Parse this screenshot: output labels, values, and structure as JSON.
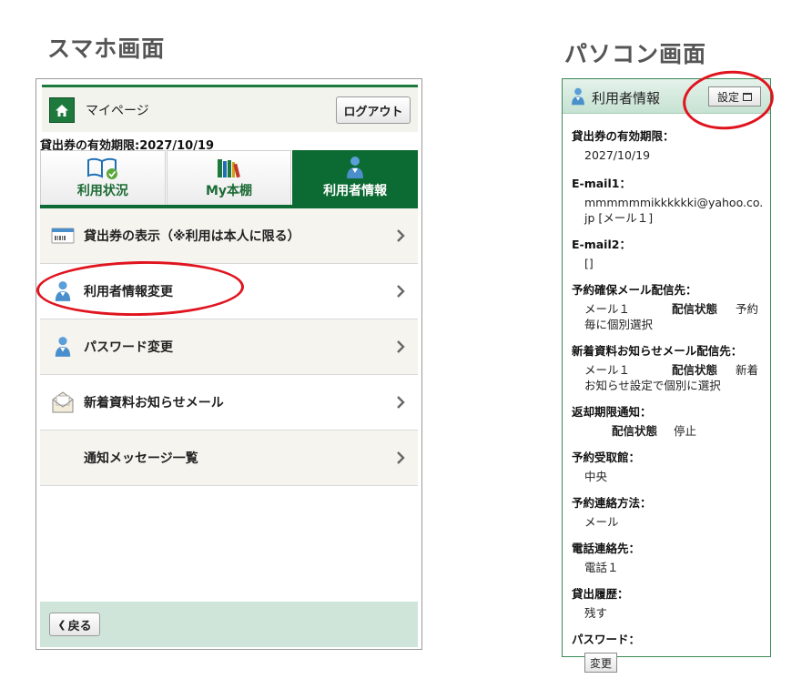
{
  "headings": {
    "phone": "スマホ画面",
    "pc": "パソコン画面"
  },
  "phone": {
    "header": {
      "title": "マイページ",
      "logout_label": "ログアウト",
      "home_icon": "home-icon"
    },
    "expiry": "貸出券の有効期限:2027/10/19",
    "tabs": [
      {
        "label": "利用状況",
        "icon": "book-check-icon",
        "active": false
      },
      {
        "label": "My本棚",
        "icon": "bookshelf-icon",
        "active": false
      },
      {
        "label": "利用者情報",
        "icon": "user-icon",
        "active": true
      }
    ],
    "menu": [
      {
        "label": "貸出券の表示（※利用は本人に限る）",
        "icon": "card-icon"
      },
      {
        "label": "利用者情報変更",
        "icon": "user-icon"
      },
      {
        "label": "パスワード変更",
        "icon": "user-icon"
      },
      {
        "label": "新着資料お知らせメール",
        "icon": "mail-icon"
      },
      {
        "label": "通知メッセージ一覧",
        "icon": ""
      }
    ],
    "footer": {
      "back_label": "戻る"
    }
  },
  "pc": {
    "title": "利用者情報",
    "settings_label": "設定",
    "fields": [
      {
        "label": "貸出券の有効期限：",
        "value": "2027/10/19"
      },
      {
        "label": "E-mail1：",
        "value": "mmmmmmikkkkkki@yahoo.co.jp [メール１]"
      },
      {
        "label": "E-mail2：",
        "value": "[]"
      },
      {
        "label": "予約確保メール配信先：",
        "value_parts": [
          "メール１",
          "配信状態",
          "予約毎に個別選択"
        ]
      },
      {
        "label": "新着資料お知らせメール配信先：",
        "value_parts": [
          "メール１",
          "配信状態",
          "新着お知らせ設定で個別に選択"
        ]
      },
      {
        "label": "返却期限通知：",
        "value_parts": [
          "配信状態",
          "停止"
        ]
      },
      {
        "label": "予約受取館：",
        "value": "中央"
      },
      {
        "label": "予約連絡方法：",
        "value": "メール"
      },
      {
        "label": "電話連絡先：",
        "value": "電話１"
      },
      {
        "label": "貸出履歴：",
        "value": "残す"
      },
      {
        "label": "パスワード：",
        "button": "変更"
      }
    ]
  },
  "colors": {
    "brand_green": "#0c6a33",
    "highlight_red": "#e0141e",
    "footer_green": "#cfe5d9"
  }
}
